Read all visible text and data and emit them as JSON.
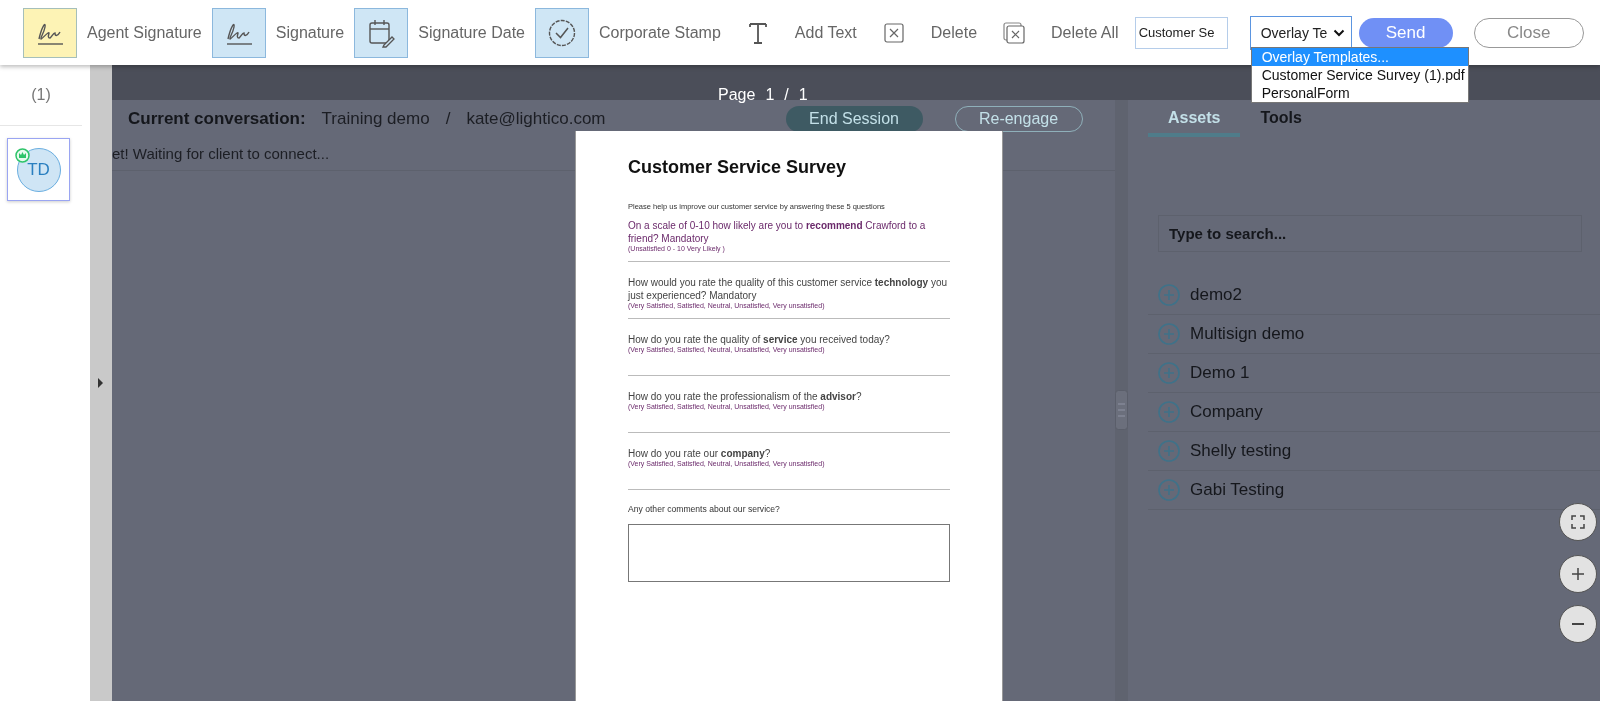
{
  "toolbar": {
    "tools": [
      {
        "kind": "agent-signature",
        "label": "Agent Signature",
        "color": "#fdf3b5"
      },
      {
        "kind": "signature",
        "label": "Signature",
        "color": "#cfe6f5"
      },
      {
        "kind": "signature-date",
        "label": "Signature Date",
        "color": "#cfe6f5"
      },
      {
        "kind": "stamp",
        "label": "Corporate Stamp",
        "color": "#cfe6f5"
      },
      {
        "kind": "text",
        "label": "Add Text"
      },
      {
        "kind": "delete",
        "label": "Delete"
      },
      {
        "kind": "delete-all",
        "label": "Delete All"
      }
    ],
    "name_field": {
      "value": "Customer Se"
    },
    "template_select": {
      "value": "Overlay Te",
      "expanded": true,
      "options": [
        {
          "label": "Overlay Templates...",
          "selected": true
        },
        {
          "label": "Customer Service Survey (1).pdf",
          "selected": false
        },
        {
          "label": "PersonalForm",
          "selected": false
        }
      ]
    },
    "buttons": [
      {
        "kind": "primary",
        "label": "Send"
      },
      {
        "kind": "secondary",
        "label": "Close"
      }
    ]
  },
  "sidebar": {
    "count": "(1)",
    "participants": [
      {
        "initials": "TD",
        "host": true,
        "selected": true
      }
    ]
  },
  "background": {
    "conversation": {
      "label": "Current conversation:",
      "name": "Training demo",
      "separator": "/",
      "email": "kate@lightico.com"
    },
    "actions": [
      {
        "kind": "filled",
        "label": "End Session"
      },
      {
        "kind": "outline",
        "label": "Re-engage"
      }
    ],
    "status": "et! Waiting for client to connect...",
    "tabs": [
      {
        "label": "Assets",
        "selected": true
      },
      {
        "label": "Tools",
        "selected": false
      }
    ],
    "search": {
      "placeholder": "Type to search..."
    },
    "assets": [
      "demo2",
      "Multisign demo",
      "Demo 1",
      "Company",
      "Shelly testing",
      "Gabi Testing"
    ]
  },
  "viewer": {
    "page_label": "Page",
    "current_page": "1",
    "separator": "/",
    "total_pages": "1",
    "document": {
      "title": "Customer Service Survey",
      "intro": "Please help us improve our customer service by answering these 5 questions",
      "questions": [
        {
          "text": "On a scale of 0-10 how likely are you to **recommend** Crawford to a friend? Mandatory",
          "hint": "(Unsatisfied 0 - 10 Very Likely )",
          "color": "#6b2a6b"
        },
        {
          "text": "How would you rate the quality of this customer service **technology** you just experienced?  Mandatory",
          "hint": "(Very Satisfied, Satisfied, Neutral, Unsatisfied, Very unsatisfied)",
          "color": "#444444"
        },
        {
          "text": "How do you rate the quality of **service** you received today?",
          "hint": "(Very Satisfied, Satisfied, Neutral, Unsatisfied, Very unsatisfied)",
          "color": "#444444"
        },
        {
          "text": "How do you rate the professionalism of the **advisor**?",
          "hint": "(Very Satisfied, Satisfied, Neutral, Unsatisfied, Very unsatisfied)",
          "color": "#444444"
        },
        {
          "text": "How do you rate our **company**?",
          "hint": "(Very Satisfied, Satisfied, Neutral, Unsatisfied, Very unsatisfied)",
          "color": "#444444"
        }
      ],
      "comments_label": "Any other comments about our service?"
    }
  }
}
